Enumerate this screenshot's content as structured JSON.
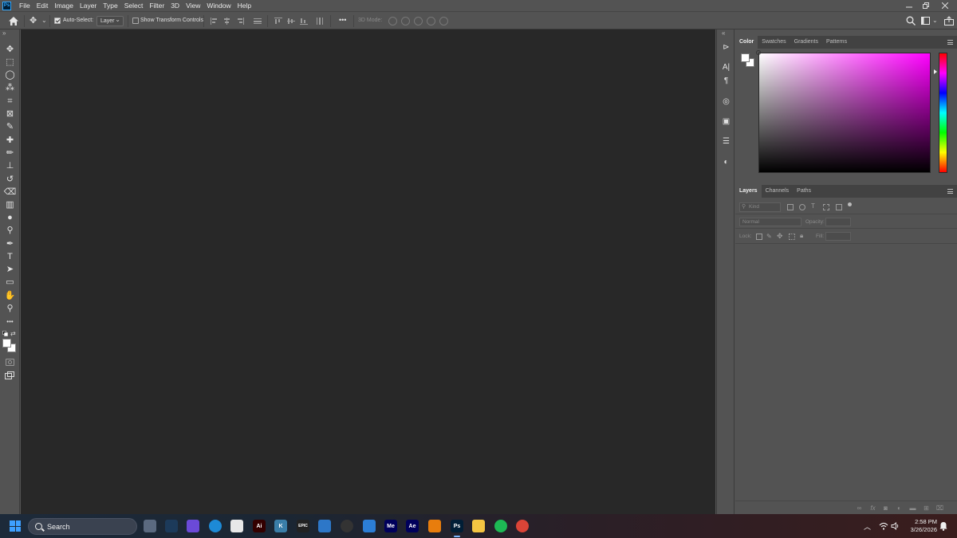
{
  "app": {
    "logo_text": "Ps"
  },
  "menubar": {
    "items": [
      "File",
      "Edit",
      "Image",
      "Layer",
      "Type",
      "Select",
      "Filter",
      "3D",
      "View",
      "Window",
      "Help"
    ],
    "window_controls": [
      "minimize-icon",
      "restore-icon",
      "close-icon"
    ]
  },
  "options": {
    "auto_select_label": "Auto-Select:",
    "auto_select_checked": true,
    "auto_select_target": "Layer",
    "show_transform_label": "Show Transform Controls",
    "show_transform_checked": false,
    "mode_3d_label": "3D Mode:",
    "more_label": "•••"
  },
  "toolbar": {
    "collapse_label": "»",
    "tools": [
      {
        "name": "move-tool",
        "glyph": "✥"
      },
      {
        "name": "rectangular-marquee-tool",
        "glyph": "⬚"
      },
      {
        "name": "lasso-tool",
        "glyph": "◯"
      },
      {
        "name": "magic-wand-tool",
        "glyph": "⁂"
      },
      {
        "name": "crop-tool",
        "glyph": "⌗"
      },
      {
        "name": "frame-tool",
        "glyph": "⊠"
      },
      {
        "name": "eyedropper-tool",
        "glyph": "✎"
      },
      {
        "name": "healing-brush-tool",
        "glyph": "✚"
      },
      {
        "name": "brush-tool",
        "glyph": "✏"
      },
      {
        "name": "clone-stamp-tool",
        "glyph": "⊥"
      },
      {
        "name": "history-brush-tool",
        "glyph": "↺"
      },
      {
        "name": "eraser-tool",
        "glyph": "⌫"
      },
      {
        "name": "gradient-tool",
        "glyph": "▥"
      },
      {
        "name": "blur-tool",
        "glyph": "●"
      },
      {
        "name": "dodge-tool",
        "glyph": "⚲"
      },
      {
        "name": "pen-tool",
        "glyph": "✒"
      },
      {
        "name": "type-tool",
        "glyph": "T"
      },
      {
        "name": "path-selection-tool",
        "glyph": "➤"
      },
      {
        "name": "rectangle-tool",
        "glyph": "▭"
      },
      {
        "name": "hand-tool",
        "glyph": "✋"
      },
      {
        "name": "zoom-tool",
        "glyph": "⚲"
      },
      {
        "name": "edit-toolbar",
        "glyph": "•••"
      }
    ]
  },
  "panels": {
    "collapse_label": "«",
    "color_tabs": [
      "Color",
      "Swatches",
      "Gradients",
      "Patterns"
    ],
    "color_active": "Color",
    "layers_tabs": [
      "Layers",
      "Channels",
      "Paths"
    ],
    "layers_active": "Layers",
    "filter_placeholder": "Kind",
    "blend_mode": "Normal",
    "opacity_label": "Opacity:",
    "lock_label": "Lock:",
    "fill_label": "Fill:",
    "footer_icons": [
      "link-icon",
      "fx-icon",
      "mask-icon",
      "adjustment-icon",
      "group-icon",
      "new-layer-icon",
      "delete-icon"
    ],
    "footer_fx_text": "fx"
  },
  "taskbar": {
    "search_label": "Search",
    "apps": [
      {
        "name": "task-view-icon",
        "label": "",
        "color": "#5b6a80"
      },
      {
        "name": "davinci-icon",
        "label": "",
        "color": "#1c3a5a"
      },
      {
        "name": "game-controller-icon",
        "label": "",
        "color": "#6b4ad8"
      },
      {
        "name": "edge-icon",
        "label": "",
        "color": "#1d8ad6"
      },
      {
        "name": "microsoft-store-icon",
        "label": "",
        "color": "#e8e8e8"
      },
      {
        "name": "illustrator-icon",
        "label": "Ai",
        "color": "#330000"
      },
      {
        "name": "kaspersky-icon",
        "label": "K",
        "color": "#3a7ea8"
      },
      {
        "name": "epic-games-icon",
        "label": "EPIC",
        "color": "#222222"
      },
      {
        "name": "window-app-icon",
        "label": "",
        "color": "#2d77c8"
      },
      {
        "name": "obs-icon",
        "label": "",
        "color": "#333333"
      },
      {
        "name": "checklist-app-icon",
        "label": "",
        "color": "#2c7ed6"
      },
      {
        "name": "media-encoder-icon",
        "label": "Me",
        "color": "#00005b"
      },
      {
        "name": "after-effects-icon",
        "label": "Ae",
        "color": "#00005b"
      },
      {
        "name": "blender-icon",
        "label": "",
        "color": "#e87d0d"
      },
      {
        "name": "photoshop-icon",
        "label": "Ps",
        "color": "#001e36"
      },
      {
        "name": "file-explorer-icon",
        "label": "",
        "color": "#f4c542"
      },
      {
        "name": "spotify-icon",
        "label": "",
        "color": "#1db954"
      },
      {
        "name": "chrome-icon",
        "label": "",
        "color": "#db4437"
      }
    ],
    "active_app": "photoshop-icon",
    "clock_time": "2:58 PM",
    "clock_date": "3/26/2026"
  },
  "colors": {
    "canvas": "#282828",
    "chrome": "#535353",
    "accent": "#31a8ff"
  }
}
